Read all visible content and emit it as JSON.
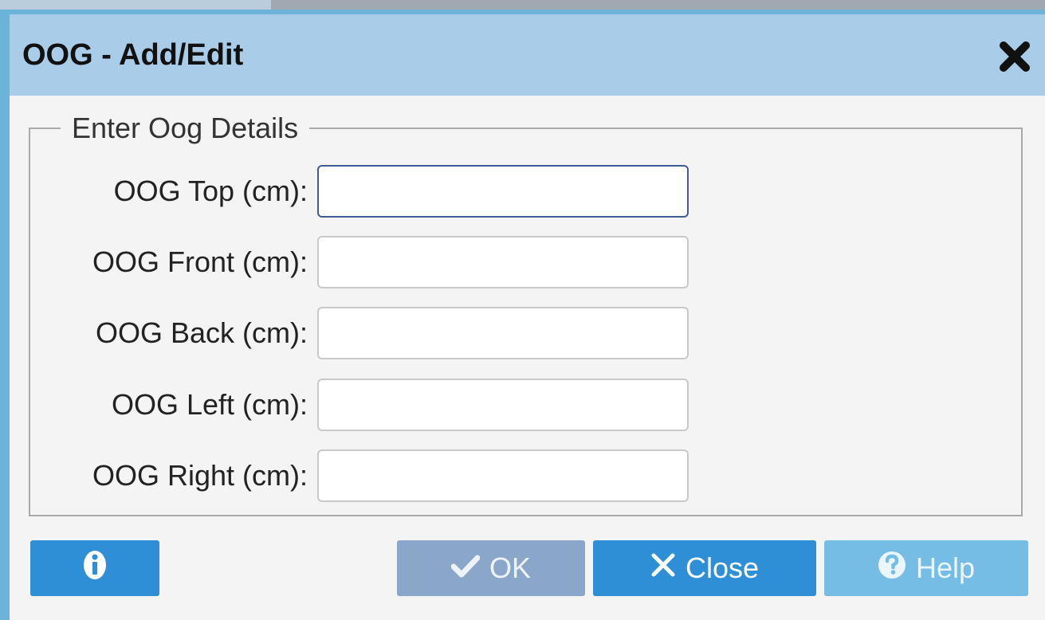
{
  "dialog": {
    "title": "OOG - Add/Edit",
    "close_icon": "close-icon"
  },
  "form": {
    "legend": "Enter Oog Details",
    "fields": [
      {
        "label": "OOG Top (cm):",
        "value": "",
        "focused": true
      },
      {
        "label": "OOG Front (cm):",
        "value": ""
      },
      {
        "label": "OOG Back (cm):",
        "value": ""
      },
      {
        "label": "OOG Left (cm):",
        "value": ""
      },
      {
        "label": "OOG Right (cm):",
        "value": ""
      }
    ]
  },
  "buttons": {
    "info_icon": "info-icon",
    "ok_label": "OK",
    "ok_icon": "checkmark-icon",
    "ok_enabled": false,
    "close_label": "Close",
    "close_icon": "x-icon",
    "help_label": "Help",
    "help_icon": "question-circle-icon",
    "help_enabled": false
  },
  "colors": {
    "title_bar": "#a9cce8",
    "primary_button": "#2e8fd6",
    "disabled_button": "#8aa7ca",
    "help_button": "#76bde6",
    "focused_border": "#3f5c94"
  }
}
